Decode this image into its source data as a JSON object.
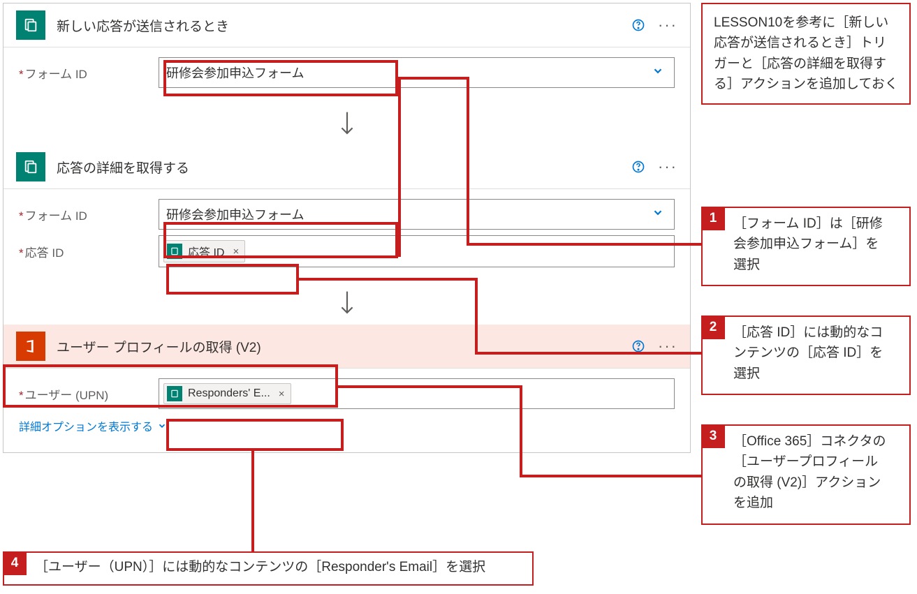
{
  "card1": {
    "title": "新しい応答が送信されるとき",
    "formIdLabel": "フォーム ID",
    "formIdValue": "研修会参加申込フォーム"
  },
  "card2": {
    "title": "応答の詳細を取得する",
    "formIdLabel": "フォーム ID",
    "formIdValue": "研修会参加申込フォーム",
    "responseIdLabel": "応答 ID",
    "responseIdToken": "応答 ID"
  },
  "card3": {
    "title": "ユーザー プロフィールの取得 (V2)",
    "userLabel": "ユーザー (UPN)",
    "userToken": "Responders' E...",
    "advancedLink": "詳細オプションを表示する"
  },
  "annotations": {
    "a0": "LESSON10を参考に［新しい応答が送信されるとき］トリガーと［応答の詳細を取得する］アクションを追加しておく",
    "a1": "［フォーム ID］は［研修会参加申込フォーム］を選択",
    "a2": "［応答 ID］には動的なコンテンツの［応答 ID］を選択",
    "a3": "［Office 365］コネクタの［ユーザープロフィールの取得 (V2)］アクションを追加",
    "a4": "［ユーザー（UPN）］には動的なコンテンツの［Responder's Email］を選択",
    "n1": "1",
    "n2": "2",
    "n3": "3",
    "n4": "4"
  },
  "icons": {
    "tokenX": "×"
  }
}
